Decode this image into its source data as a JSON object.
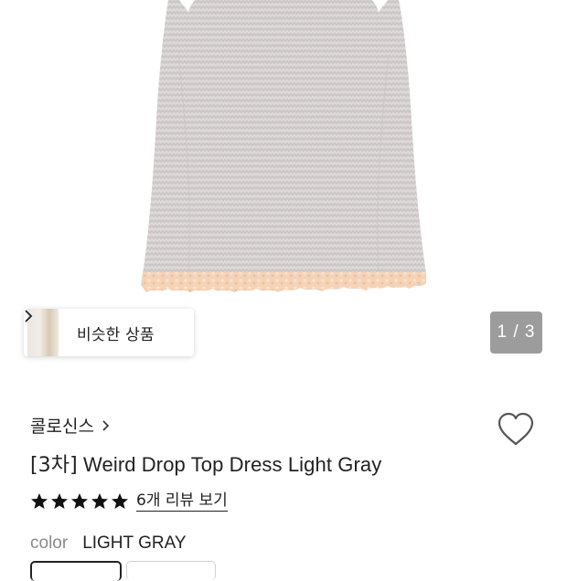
{
  "gallery": {
    "similar_label": "비슷한 상품",
    "pager": "1 / 3"
  },
  "product": {
    "brand": "콜로신스",
    "title_prefix": "[3차]",
    "title": "Weird Drop Top Dress Light Gray",
    "rating_stars": 5,
    "review_link": "6개 리뷰 보기",
    "color_key": "color",
    "color_value": "LIGHT GRAY"
  },
  "colors": {
    "dress": "#d6d1d1",
    "lace": "#f3cfb0"
  }
}
